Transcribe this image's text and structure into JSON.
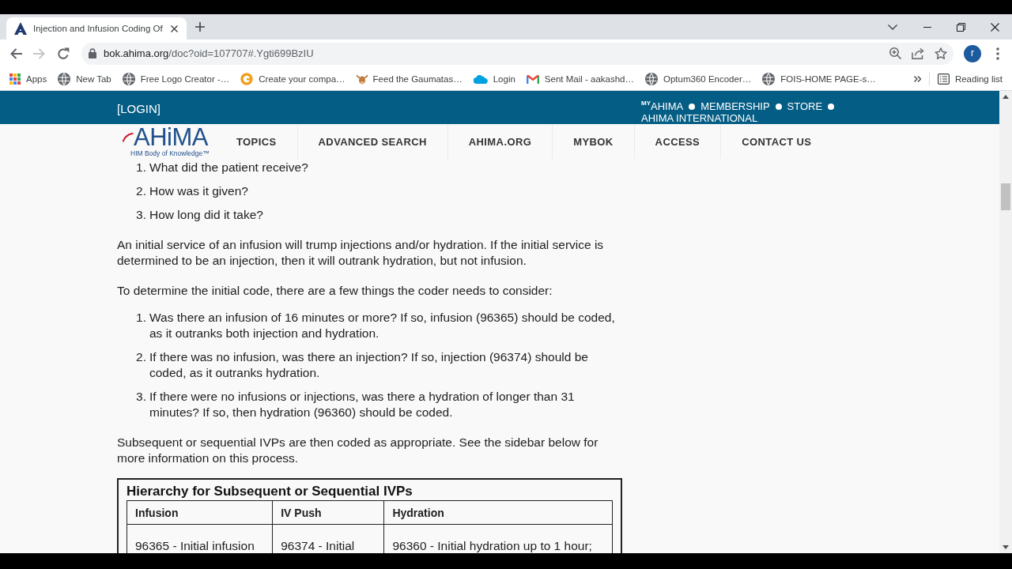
{
  "browser": {
    "tabs": [
      {
        "title": "Injection and Infusion Coding Of",
        "selected": true
      }
    ],
    "nav_buttons": [
      {
        "kind": "back",
        "disabled": false
      },
      {
        "kind": "forward",
        "disabled": true
      },
      {
        "kind": "reload",
        "disabled": false
      }
    ],
    "address": {
      "host": "bok.ahima.org",
      "path": "/doc?oid=107707#.Ygti699BzIU"
    },
    "profile": {
      "initial": "r"
    },
    "bookmarks": [
      {
        "kind": "apps",
        "label": "Apps"
      },
      {
        "kind": "globe",
        "label": "New Tab"
      },
      {
        "kind": "globe",
        "label": "Free Logo Creator -…"
      },
      {
        "kind": "ring",
        "label": "Create your compa…"
      },
      {
        "kind": "bull",
        "label": "Feed the Gaumatas…"
      },
      {
        "kind": "cloud",
        "label": "Login"
      },
      {
        "kind": "mail",
        "label": "Sent Mail - aakashd…"
      },
      {
        "kind": "globe",
        "label": "Optum360 Encoder…"
      },
      {
        "kind": "globe",
        "label": "FOIS-HOME PAGE-s…"
      }
    ],
    "reading_list": {
      "label": "Reading list"
    }
  },
  "site": {
    "top_bar": {
      "login": "[LOGIN]",
      "links": [
        "$^{MY}$AHIMA",
        "MEMBERSHIP",
        "STORE",
        "AHIMA INTERNATIONAL"
      ]
    },
    "logo": {
      "wordmark": "AHiMA",
      "tagline": "HIM Body of Knowledge™"
    },
    "nav": [
      "TOPICS",
      "ADVANCED SEARCH",
      "AHIMA.ORG",
      "MYBOK",
      "ACCESS",
      "CONTACT US"
    ],
    "article": {
      "blocks": [
        {
          "kind": "list",
          "items": [
            {
              "number": "1.",
              "text": "What did the patient receive?"
            },
            {
              "number": "2.",
              "text": "How was it given?"
            },
            {
              "number": "3.",
              "text": "How long did it take?"
            }
          ]
        },
        {
          "kind": "paragraph",
          "text": "An initial service of an infusion will trump injections and/or hydration. If the initial service is determined to be an injection, then it will outrank hydration, but not infusion."
        },
        {
          "kind": "paragraph",
          "text": "To determine the initial code, there are a few things the coder needs to consider:"
        },
        {
          "kind": "list",
          "items": [
            {
              "number": "1.",
              "text": "Was there an infusion of 16 minutes or more? If so, infusion (96365) should be coded, as it outranks both injection and hydration."
            },
            {
              "number": "2.",
              "text": "If there was no infusion, was there an injection? If so, injection (96374) should be coded, as it outranks hydration."
            },
            {
              "number": "3.",
              "text": "If there were no infusions or injections, was there a hydration of longer than 31 minutes? If so, then hydration (96360) should be coded."
            }
          ]
        },
        {
          "kind": "paragraph",
          "text": "Subsequent or sequential IVPs are then coded as appropriate. See the sidebar below for more information on this process."
        },
        {
          "kind": "table",
          "title": "Hierarchy for Subsequent or Sequential IVPs",
          "columns": [
            "Infusion",
            "IV Push",
            "Hydration"
          ],
          "rows": [
            [
              "96365 - Initial infusion",
              "96374 - Initial",
              "96360 - Initial hydration up to 1 hour;"
            ]
          ]
        }
      ]
    }
  }
}
